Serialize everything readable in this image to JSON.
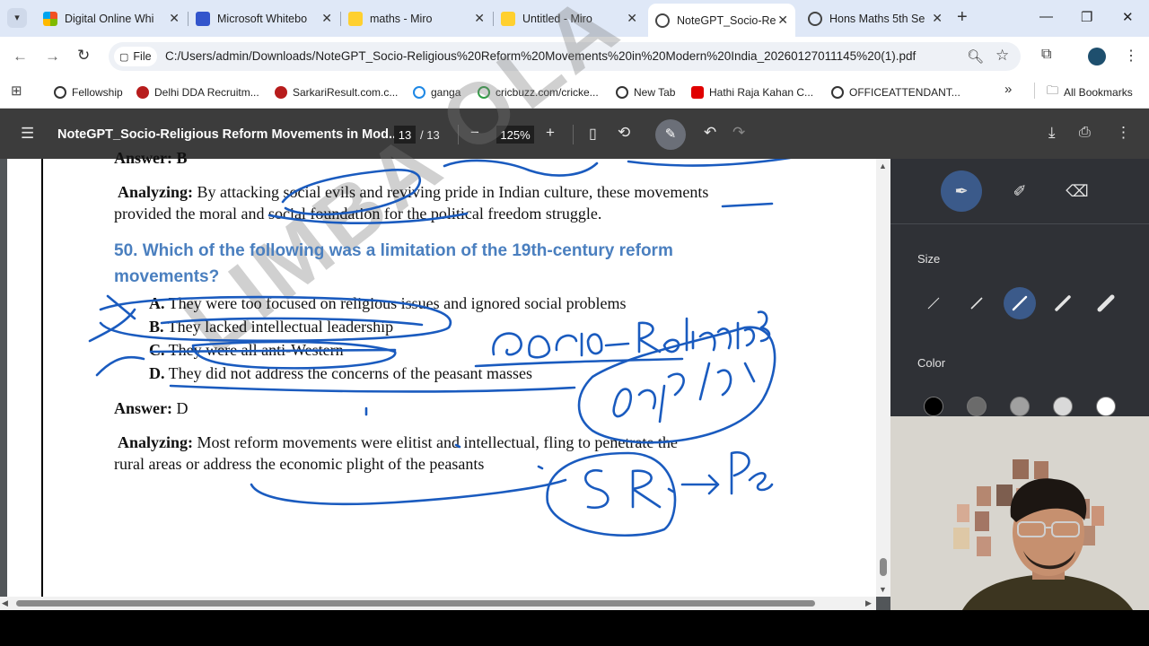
{
  "browser": {
    "tabs": [
      {
        "title": "Digital Online Whi",
        "favicon": "microsoft-icon",
        "color": "#f25022"
      },
      {
        "title": "Microsoft Whitebo",
        "favicon": "whiteboard-icon",
        "color": "#3355cc"
      },
      {
        "title": "maths - Miro",
        "favicon": "miro-icon",
        "color": "#ffd02f"
      },
      {
        "title": "Untitled - Miro",
        "favicon": "miro-icon",
        "color": "#ffd02f"
      },
      {
        "title": "NoteGPT_Socio-Re",
        "favicon": "globe-icon",
        "color": "#444444"
      },
      {
        "title": "Hons Maths 5th Se",
        "favicon": "globe-icon",
        "color": "#444444"
      }
    ],
    "active_tab": 4,
    "address": {
      "scheme_label": "File",
      "url": "C:/Users/admin/Downloads/NoteGPT_Socio-Religious%20Reform%20Movements%20in%20Modern%20India_20260127011145%20(1).pdf"
    },
    "bookmarks": [
      {
        "label": "Fellowship",
        "color": "#333333"
      },
      {
        "label": "Delhi DDA Recruitm...",
        "color": "#b71c1c"
      },
      {
        "label": "SarkariResult.com.c...",
        "color": "#b71c1c"
      },
      {
        "label": "ganga",
        "color": "#1e88e5"
      },
      {
        "label": "cricbuzz.com/cricke...",
        "color": "#2e9e44"
      },
      {
        "label": "New Tab",
        "color": "#333333"
      },
      {
        "label": "Hathi Raja Kahan C...",
        "color": "#e00000"
      },
      {
        "label": "OFFICEATTENDANT...",
        "color": "#333333"
      }
    ],
    "bookmarks_overflow": "»",
    "all_bookmarks": "All Bookmarks"
  },
  "pdf": {
    "title": "NoteGPT_Socio-Religious Reform Movements in Mod...",
    "page_current": "13",
    "page_total": "/ 13",
    "zoom": "125%"
  },
  "content": {
    "prev_answer": "Answer: B",
    "analyzing1_label": "Analyzing:",
    "analyzing1_line1": " By attacking social evils and reviving pride in Indian culture, these movements",
    "analyzing1_line2": "provided the moral and social foundation for the political freedom struggle.",
    "question_line1": "50. Which of the following was a limitation of the 19th-century reform",
    "question_line2": "movements?",
    "options": [
      {
        "letter": "A.",
        "text": " They were too focused on religious issues and ignored social problems"
      },
      {
        "letter": "B.",
        "text": " They lacked intellectual leadership"
      },
      {
        "letter": "C.",
        "text": " They were all anti-Western"
      },
      {
        "letter": "D.",
        "text": " They did not address the concerns of the peasant masses"
      }
    ],
    "answer_label": "Answer:",
    "answer_value": " D",
    "analyzing2_label": "Analyzing:",
    "analyzing2_line1": " Most reform movements were elitist and intellectual, fling to penetrate the",
    "analyzing2_line2": "rural areas or address the economic plight of the peasants",
    "watermark": "LIMBA OLA"
  },
  "handwriting": {
    "word1": "Socio - Religious",
    "word2": "best bi",
    "word3": "S R",
    "word4": "Pe",
    "ink_color": "#1a5bbf"
  },
  "annotation_panel": {
    "size_label": "Size",
    "color_label": "Color",
    "selected_size": 2,
    "colors": [
      "#000000",
      "#6b6b6b",
      "#a0a0a0",
      "#d9d9d9",
      "#ffffff"
    ]
  }
}
